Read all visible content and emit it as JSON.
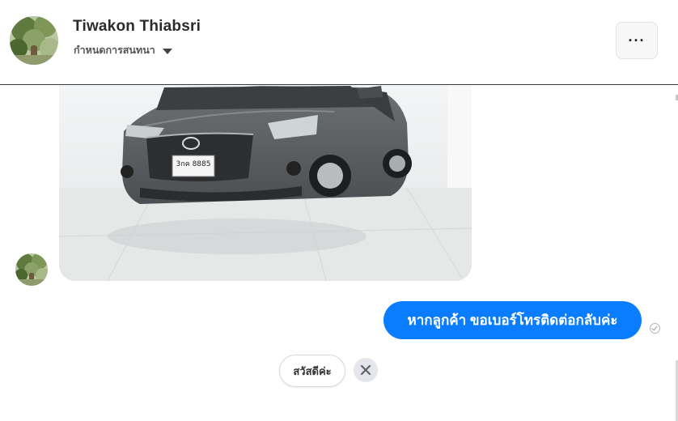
{
  "conversation": {
    "contact_name": "Tiwakon Thiabsri",
    "subtitle": "กำหนดการสนทนา",
    "more_label": "···"
  },
  "messages": {
    "outgoing_text": "หากลูกค้า ขอเบอร์โทรติดต่อกลับค่ะ"
  },
  "photo": {
    "plate_line1": "3กค 8885"
  },
  "quick_reply": {
    "label": "สวัสดีค่ะ"
  },
  "colors": {
    "accent": "#0a7cff",
    "header_divider": "#3a3a3a"
  },
  "icons": {
    "caret": "caret-down-icon",
    "more": "more-dots-icon",
    "seen": "seen-check-icon",
    "close": "close-icon"
  }
}
